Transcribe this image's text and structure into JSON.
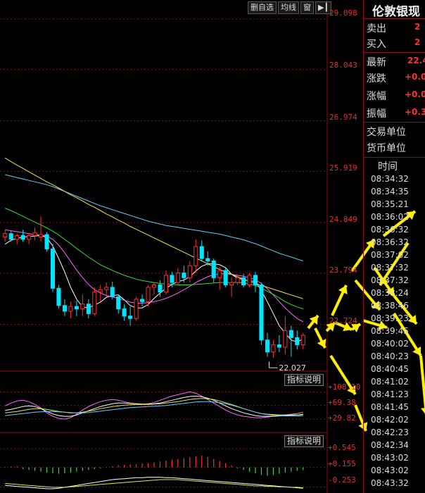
{
  "toolbar": {
    "delete_watch": "删自选",
    "ma_lines": "均线",
    "window": "窗",
    "play_icon": "play-triangle-icon"
  },
  "chart_data": {
    "type": "candlestick",
    "y_axis_labels": [
      "29.098",
      "28.043",
      "26.974",
      "25.919",
      "24.849",
      "23.794",
      "22.724"
    ],
    "ylim": [
      22.0,
      29.2
    ],
    "min_marker": "22.027",
    "candles": [
      [
        24.55,
        24.7,
        24.45,
        24.62
      ],
      [
        24.62,
        24.68,
        24.45,
        24.5
      ],
      [
        24.5,
        24.62,
        24.4,
        24.58
      ],
      [
        24.58,
        24.7,
        24.45,
        24.5
      ],
      [
        24.5,
        24.62,
        24.4,
        24.58
      ],
      [
        24.58,
        24.75,
        24.48,
        24.64
      ],
      [
        24.55,
        24.98,
        24.45,
        24.6
      ],
      [
        24.6,
        24.65,
        24.25,
        24.3
      ],
      [
        24.3,
        24.4,
        23.4,
        23.48
      ],
      [
        23.48,
        23.55,
        23.05,
        23.12
      ],
      [
        23.12,
        23.25,
        22.9,
        23.0
      ],
      [
        23.0,
        23.2,
        22.85,
        23.1
      ],
      [
        23.1,
        23.22,
        22.9,
        23.05
      ],
      [
        23.05,
        23.35,
        22.9,
        23.15
      ],
      [
        23.15,
        23.25,
        22.85,
        22.95
      ],
      [
        22.95,
        23.5,
        22.9,
        23.4
      ],
      [
        23.4,
        23.55,
        23.2,
        23.45
      ],
      [
        23.45,
        23.6,
        23.3,
        23.5
      ],
      [
        23.5,
        23.62,
        23.25,
        23.3
      ],
      [
        23.3,
        23.35,
        22.95,
        23.05
      ],
      [
        23.05,
        23.15,
        22.8,
        22.9
      ],
      [
        22.9,
        23.1,
        22.7,
        22.85
      ],
      [
        22.85,
        23.3,
        22.8,
        23.25
      ],
      [
        23.25,
        23.35,
        23.1,
        23.2
      ],
      [
        23.2,
        23.55,
        23.1,
        23.5
      ],
      [
        23.5,
        23.6,
        23.35,
        23.55
      ],
      [
        23.55,
        23.65,
        23.3,
        23.4
      ],
      [
        23.4,
        23.85,
        23.35,
        23.75
      ],
      [
        23.75,
        23.82,
        23.5,
        23.6
      ],
      [
        23.6,
        23.9,
        23.55,
        23.8
      ],
      [
        23.8,
        23.95,
        23.6,
        23.7
      ],
      [
        23.7,
        24.05,
        23.6,
        23.95
      ],
      [
        23.95,
        24.5,
        23.8,
        24.35
      ],
      [
        24.35,
        24.48,
        24.05,
        24.1
      ],
      [
        24.1,
        24.25,
        23.95,
        24.05
      ],
      [
        24.05,
        24.1,
        23.6,
        23.7
      ],
      [
        23.7,
        23.92,
        23.45,
        23.85
      ],
      [
        23.85,
        23.9,
        23.5,
        23.55
      ],
      [
        23.55,
        23.7,
        23.3,
        23.6
      ],
      [
        23.6,
        23.75,
        23.55,
        23.7
      ],
      [
        23.7,
        23.78,
        23.5,
        23.55
      ],
      [
        23.55,
        23.8,
        23.5,
        23.75
      ],
      [
        23.75,
        23.82,
        23.4,
        23.55
      ],
      [
        23.55,
        23.6,
        22.3,
        22.4
      ],
      [
        22.4,
        22.55,
        22.05,
        22.15
      ],
      [
        22.15,
        22.4,
        22.03,
        22.3
      ],
      [
        22.3,
        22.5,
        22.15,
        22.25
      ],
      [
        22.25,
        22.9,
        22.1,
        22.6
      ],
      [
        22.6,
        22.7,
        22.05,
        22.45
      ],
      [
        22.45,
        22.6,
        22.2,
        22.3
      ],
      [
        22.3,
        22.55,
        22.2,
        22.5
      ]
    ],
    "ma_series": [
      {
        "color": "#ffffff",
        "values": [
          24.4,
          24.48,
          24.52,
          24.55,
          24.56,
          24.57,
          24.58,
          24.54,
          24.36,
          24.1,
          23.82,
          23.5,
          23.25,
          23.09,
          23.07,
          23.13,
          23.19,
          23.29,
          23.33,
          23.34,
          23.24,
          23.12,
          23.07,
          23.07,
          23.14,
          23.27,
          23.38,
          23.48,
          23.56,
          23.62,
          23.65,
          23.72,
          23.84,
          23.94,
          23.99,
          23.99,
          23.97,
          23.91,
          23.77,
          23.69,
          23.66,
          23.63,
          23.63,
          23.43,
          23.2,
          22.95,
          22.7,
          22.54,
          22.4,
          22.36,
          22.42
        ]
      },
      {
        "color": "#ff66ff",
        "values": [
          24.7,
          24.68,
          24.66,
          24.64,
          24.62,
          24.6,
          24.59,
          24.57,
          24.5,
          24.38,
          24.22,
          24.04,
          23.86,
          23.7,
          23.56,
          23.45,
          23.38,
          23.33,
          23.3,
          23.27,
          23.23,
          23.19,
          23.17,
          23.17,
          23.18,
          23.2,
          23.23,
          23.27,
          23.32,
          23.38,
          23.45,
          23.52,
          23.6,
          23.66,
          23.72,
          23.76,
          23.78,
          23.78,
          23.77,
          23.75,
          23.73,
          23.7,
          23.66,
          23.58,
          23.47,
          23.34,
          23.2,
          23.07,
          22.95,
          22.85,
          22.78
        ]
      },
      {
        "color": "#33dd33",
        "values": [
          25.15,
          25.1,
          25.04,
          24.98,
          24.92,
          24.86,
          24.8,
          24.74,
          24.67,
          24.59,
          24.5,
          24.41,
          24.31,
          24.22,
          24.13,
          24.05,
          23.97,
          23.91,
          23.85,
          23.8,
          23.75,
          23.71,
          23.67,
          23.64,
          23.62,
          23.6,
          23.58,
          23.57,
          23.56,
          23.55,
          23.55,
          23.55,
          23.56,
          23.57,
          23.58,
          23.59,
          23.6,
          23.6,
          23.6,
          23.6,
          23.59,
          23.57,
          23.54,
          23.48,
          23.42,
          23.35,
          23.28,
          23.2,
          23.14,
          23.09,
          23.05
        ]
      },
      {
        "color": "#66ccff",
        "values": [
          25.85,
          25.82,
          25.79,
          25.76,
          25.73,
          25.7,
          25.67,
          25.64,
          25.6,
          25.55,
          25.5,
          25.45,
          25.4,
          25.35,
          25.3,
          25.25,
          25.2,
          25.16,
          25.12,
          25.08,
          25.04,
          25.0,
          24.96,
          24.92,
          24.88,
          24.85,
          24.82,
          24.79,
          24.77,
          24.75,
          24.73,
          24.71,
          24.69,
          24.67,
          24.65,
          24.63,
          24.61,
          24.58,
          24.55,
          24.52,
          24.49,
          24.45,
          24.41,
          24.36,
          24.31,
          24.26,
          24.21,
          24.17,
          24.13,
          24.09,
          24.05
        ]
      },
      {
        "color": "#e8e84a",
        "values": [
          26.2,
          26.12,
          26.05,
          25.98,
          25.91,
          25.84,
          25.77,
          25.7,
          25.64,
          25.57,
          25.5,
          25.43,
          25.37,
          25.3,
          25.23,
          25.17,
          25.1,
          25.03,
          24.97,
          24.9,
          24.84,
          24.77,
          24.71,
          24.65,
          24.59,
          24.53,
          24.47,
          24.41,
          24.35,
          24.29,
          24.23,
          24.17,
          24.11,
          24.05,
          23.99,
          23.93,
          23.87,
          23.82,
          23.77,
          23.72,
          23.67,
          23.62,
          23.58,
          23.54,
          23.5,
          23.46,
          23.42,
          23.38,
          23.34,
          23.3,
          23.26
        ]
      }
    ],
    "ind1": {
      "labels": [
        "+108.10",
        "+69.38",
        "+29.82"
      ],
      "ylim": [
        10,
        125
      ],
      "series": [
        {
          "color": "#ff66ff",
          "values": [
            68,
            76,
            82,
            84,
            80,
            72,
            62,
            48,
            38,
            32,
            30,
            34,
            44,
            56,
            66,
            74,
            80,
            84,
            86,
            84,
            80,
            76,
            74,
            72,
            74,
            78,
            84,
            90,
            96,
            100,
            104,
            108,
            104,
            96,
            86,
            76,
            66,
            56,
            48,
            42,
            38,
            36,
            34,
            34,
            36,
            38,
            40,
            42,
            44,
            46,
            50
          ]
        },
        {
          "color": "#ffffff",
          "values": [
            55,
            58,
            62,
            66,
            68,
            66,
            60,
            52,
            45,
            40,
            38,
            38,
            42,
            48,
            54,
            60,
            66,
            70,
            74,
            76,
            76,
            75,
            74,
            73,
            73,
            74,
            76,
            80,
            84,
            88,
            92,
            95,
            96,
            94,
            90,
            84,
            76,
            68,
            60,
            54,
            48,
            44,
            40,
            38,
            38,
            38,
            39,
            40,
            41,
            42,
            44
          ]
        },
        {
          "color": "#e8e84a",
          "values": [
            48,
            50,
            52,
            55,
            58,
            60,
            60,
            58,
            55,
            52,
            50,
            48,
            48,
            50,
            53,
            56,
            60,
            63,
            66,
            68,
            70,
            71,
            72,
            72,
            72,
            73,
            74,
            76,
            78,
            80,
            83,
            86,
            88,
            89,
            88,
            86,
            82,
            77,
            72,
            66,
            60,
            55,
            50,
            46,
            44,
            43,
            42,
            42,
            42,
            42,
            43
          ]
        },
        {
          "color": "#66ccff",
          "values": [
            40,
            42,
            44,
            46,
            48,
            50,
            51,
            52,
            52,
            51,
            50,
            49,
            48,
            48,
            49,
            51,
            53,
            55,
            57,
            59,
            61,
            63,
            64,
            65,
            66,
            67,
            68,
            69,
            71,
            73,
            75,
            77,
            79,
            80,
            80,
            79,
            77,
            74,
            70,
            65,
            60,
            55,
            50,
            46,
            43,
            41,
            40,
            39,
            39,
            39,
            40
          ]
        }
      ]
    },
    "ind2": {
      "labels": [
        "+0.545",
        "+0.155",
        "-0.253"
      ],
      "ylim": [
        -0.32,
        0.62
      ],
      "bars": [
        0.01,
        0.02,
        0.03,
        -0.04,
        -0.06,
        -0.08,
        -0.1,
        -0.12,
        -0.14,
        -0.15,
        -0.14,
        -0.12,
        -0.1,
        -0.08,
        -0.06,
        -0.04,
        -0.02,
        0.01,
        0.03,
        0.05,
        0.06,
        0.07,
        0.08,
        0.09,
        0.1,
        0.12,
        0.14,
        0.16,
        0.18,
        0.2,
        0.22,
        0.24,
        0.26,
        0.28,
        0.25,
        0.2,
        0.15,
        0.1,
        0.05,
        -0.02,
        -0.06,
        -0.1,
        -0.14,
        -0.18,
        -0.2,
        -0.18,
        -0.15,
        -0.12,
        -0.1,
        -0.08,
        -0.06
      ],
      "lines": [
        {
          "color": "#ffffff",
          "values": [
            -0.22,
            -0.23,
            -0.24,
            -0.25,
            -0.26,
            -0.27,
            -0.28,
            -0.29,
            -0.29,
            -0.28,
            -0.26,
            -0.24,
            -0.22,
            -0.2,
            -0.18,
            -0.16,
            -0.14,
            -0.12,
            -0.1,
            -0.09,
            -0.08,
            -0.07,
            -0.06,
            -0.06,
            -0.05,
            -0.05,
            -0.05,
            -0.06,
            -0.06,
            -0.07,
            -0.08,
            -0.09,
            -0.1,
            -0.11,
            -0.12,
            -0.13,
            -0.14,
            -0.15,
            -0.16,
            -0.17,
            -0.18,
            -0.19,
            -0.2,
            -0.21,
            -0.22,
            -0.23,
            -0.24,
            -0.25,
            -0.26,
            -0.27,
            -0.28
          ]
        },
        {
          "color": "#e8e84a",
          "values": [
            -0.18,
            -0.19,
            -0.2,
            -0.21,
            -0.22,
            -0.23,
            -0.24,
            -0.25,
            -0.26,
            -0.26,
            -0.26,
            -0.25,
            -0.24,
            -0.23,
            -0.22,
            -0.21,
            -0.2,
            -0.19,
            -0.18,
            -0.17,
            -0.16,
            -0.15,
            -0.14,
            -0.13,
            -0.12,
            -0.11,
            -0.1,
            -0.1,
            -0.1,
            -0.1,
            -0.11,
            -0.12,
            -0.13,
            -0.14,
            -0.15,
            -0.16,
            -0.17,
            -0.18,
            -0.19,
            -0.2,
            -0.21,
            -0.22,
            -0.23,
            -0.23,
            -0.24,
            -0.24,
            -0.25,
            -0.25,
            -0.26,
            -0.26,
            -0.27
          ]
        }
      ]
    }
  },
  "indicator_button": "指标说明",
  "side_panel": {
    "title": "伦敦银现",
    "sell_label": "卖出",
    "sell_value": "2",
    "buy_label": "买入",
    "buy_value": "2",
    "last_label": "最新",
    "last_value": "22.4",
    "change_label": "涨跌",
    "change_value": "+0.0",
    "change_pct_label": "涨幅",
    "change_pct_value": "+0.0",
    "amplitude_label": "振幅",
    "amplitude_value": "+0.3",
    "trade_unit_label": "交易单位",
    "currency_unit_label": "货币单位",
    "time_header": "时间",
    "times": [
      "08:34:32",
      "08:34:35",
      "08:35:21",
      "08:36:02",
      "08:36:32",
      "08:36:32",
      "08:37:02",
      "08:37:32",
      "08:37:32",
      "08:38:24",
      "08:38:46",
      "08:39:23",
      "08:39:45",
      "08:40:02",
      "08:40:23",
      "08:40:45",
      "08:41:02",
      "08:41:23",
      "08:41:45",
      "08:42:02",
      "08:42:23",
      "08:42:34",
      "08:43:02",
      "08:43:02",
      "08:43:32"
    ]
  },
  "annotation_color": "#ffee00",
  "up_color": "#ff3030",
  "down_color": "#00e5ff"
}
